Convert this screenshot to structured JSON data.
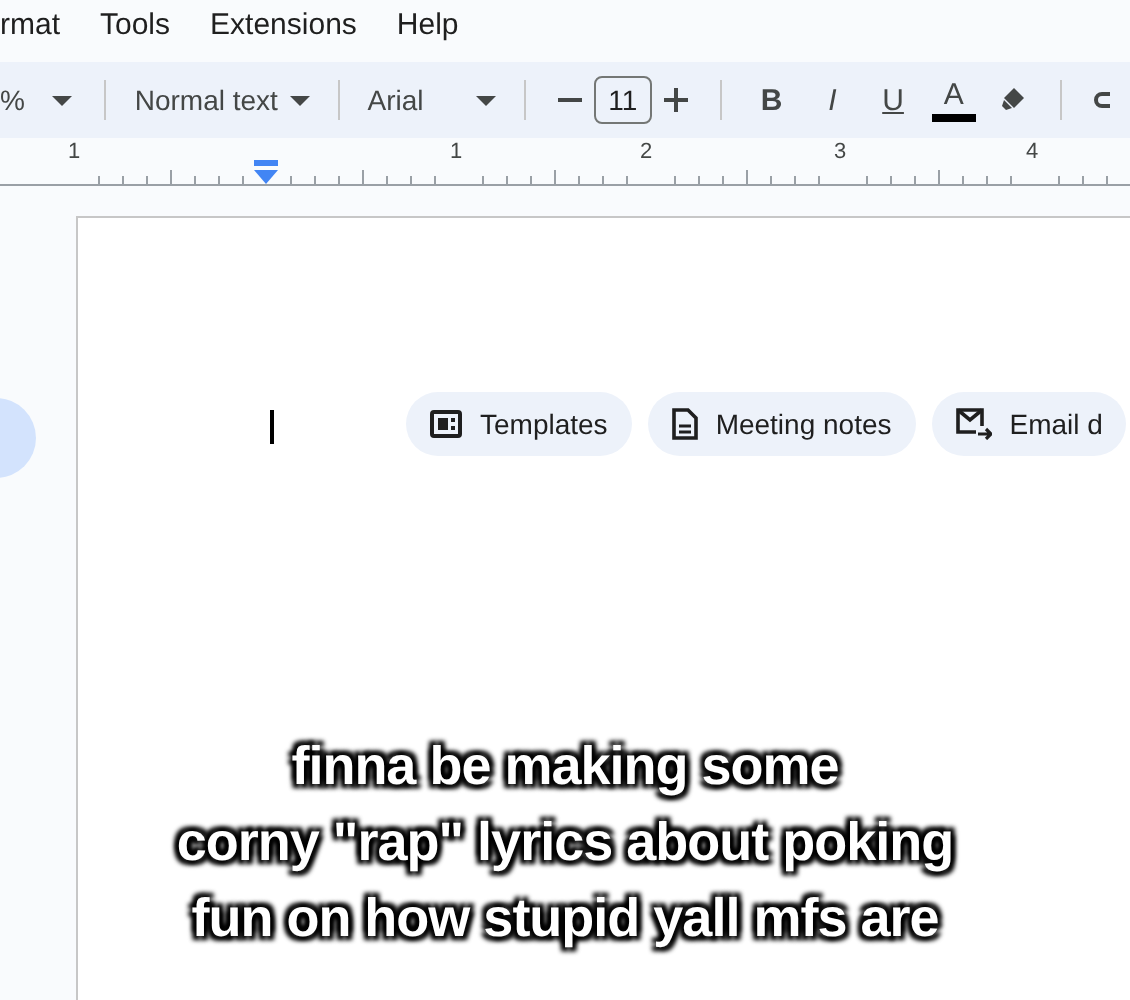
{
  "menu": [
    "rmat",
    "Tools",
    "Extensions",
    "Help"
  ],
  "toolbar": {
    "zoom": "%",
    "style": "Normal text",
    "font": "Arial",
    "size": "11",
    "format_buttons": [
      {
        "kind": "bold",
        "label": "B"
      },
      {
        "kind": "italic",
        "label": "I"
      },
      {
        "kind": "underline",
        "label": "U"
      },
      {
        "kind": "color",
        "label": "A",
        "color": "#000000"
      }
    ]
  },
  "ruler": [
    "1",
    "1",
    "2",
    "3",
    "4"
  ],
  "chips": [
    {
      "kind": "templates",
      "label": "Templates"
    },
    {
      "kind": "notes",
      "label": "Meeting notes"
    },
    {
      "kind": "email",
      "label": "Email d"
    }
  ],
  "caption": [
    "finna be making some",
    "corny \"rap\" lyrics about poking",
    "fun on how stupid yall mfs are"
  ]
}
